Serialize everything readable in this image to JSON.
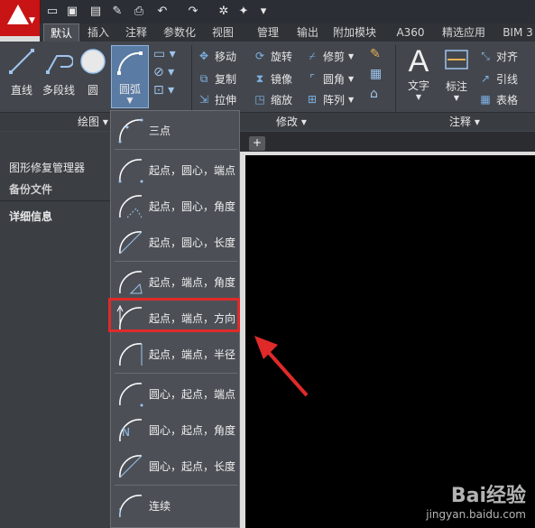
{
  "tabs": [
    "默认",
    "插入",
    "注释",
    "参数化",
    "视图",
    "管理",
    "输出",
    "附加模块",
    "A360",
    "精选应用",
    "BIM 3"
  ],
  "draw_tools": [
    {
      "label": "直线"
    },
    {
      "label": "多段线"
    },
    {
      "label": "圆"
    },
    {
      "label": "圆弧"
    }
  ],
  "modify_tools": [
    "移动",
    "旋转",
    "修剪",
    "复制",
    "镜像",
    "圆角",
    "拉伸",
    "缩放",
    "阵列"
  ],
  "annot_tools": {
    "text": "文字",
    "dim": "标注",
    "align": "对齐",
    "leader": "引线",
    "table": "表格"
  },
  "groups": {
    "draw": "绘图",
    "modify": "修改",
    "annot": "注释"
  },
  "file_tab": "开始",
  "panel": {
    "item1": "图形修复管理器",
    "item2": "备份文件",
    "item3": "详细信息"
  },
  "arc_menu": [
    {
      "label": "三点"
    },
    {
      "label": "起点，圆心，端点"
    },
    {
      "label": "起点，圆心，角度"
    },
    {
      "label": "起点，圆心，长度"
    },
    {
      "label": "起点，端点，角度"
    },
    {
      "label": "起点，端点，方向"
    },
    {
      "label": "起点，端点，半径"
    },
    {
      "label": "圆心，起点，端点"
    },
    {
      "label": "圆心，起点，角度"
    },
    {
      "label": "圆心，起点，长度"
    },
    {
      "label": "连续"
    }
  ],
  "watermark": {
    "brand": "Bai经验",
    "url": "jingyan.baidu.com"
  },
  "colors": {
    "accent": "#c81414",
    "highlight": "#e02a2a",
    "canvas": "#000000"
  }
}
